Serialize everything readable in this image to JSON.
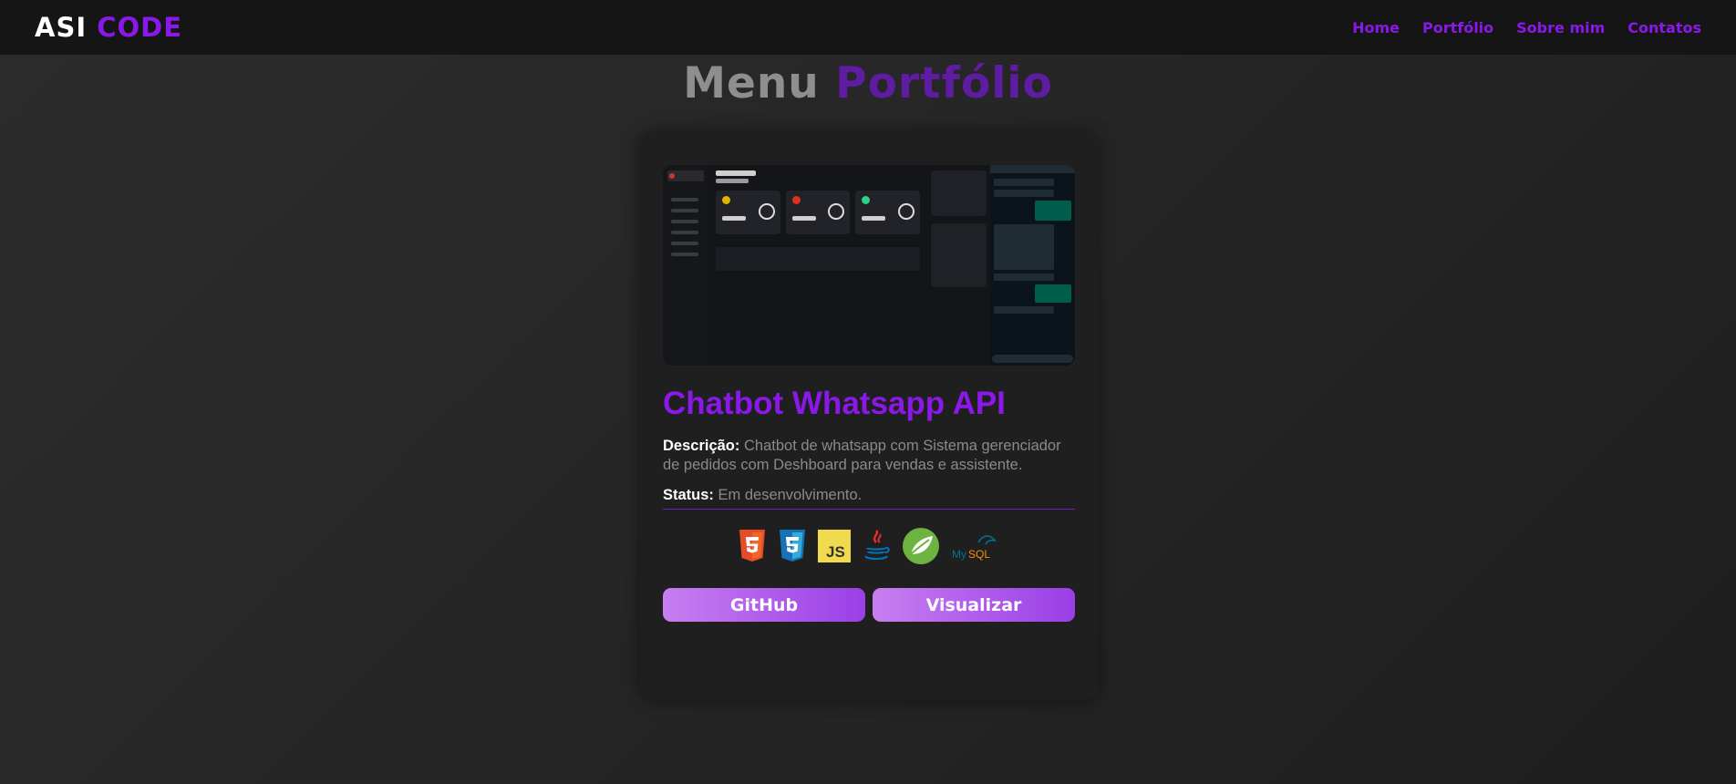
{
  "header": {
    "logo_part1": "ASI",
    "logo_part2": "CODE",
    "nav": [
      "Home",
      "Portfólio",
      "Sobre mim",
      "Contatos"
    ]
  },
  "page": {
    "title_part1": "Menu",
    "title_part2": "Portfólio"
  },
  "project": {
    "title": "Chatbot Whatsapp API",
    "description_label": "Descrição:",
    "description": "Chatbot de whatsapp com Sistema gerenciador de pedidos com Deshboard para vendas e assistente.",
    "status_label": "Status:",
    "status": "Em desenvolvimento.",
    "technologies": [
      "html5-icon",
      "css3-icon",
      "javascript-icon",
      "java-icon",
      "spring-icon",
      "mysql-icon"
    ],
    "buttons": {
      "github": "GitHub",
      "view": "Visualizar"
    }
  },
  "colors": {
    "accent": "#8a18e8",
    "title_gray": "#8e8e8e",
    "title_purple": "#5e1ca3",
    "card_bg": "#1f1f1f"
  }
}
